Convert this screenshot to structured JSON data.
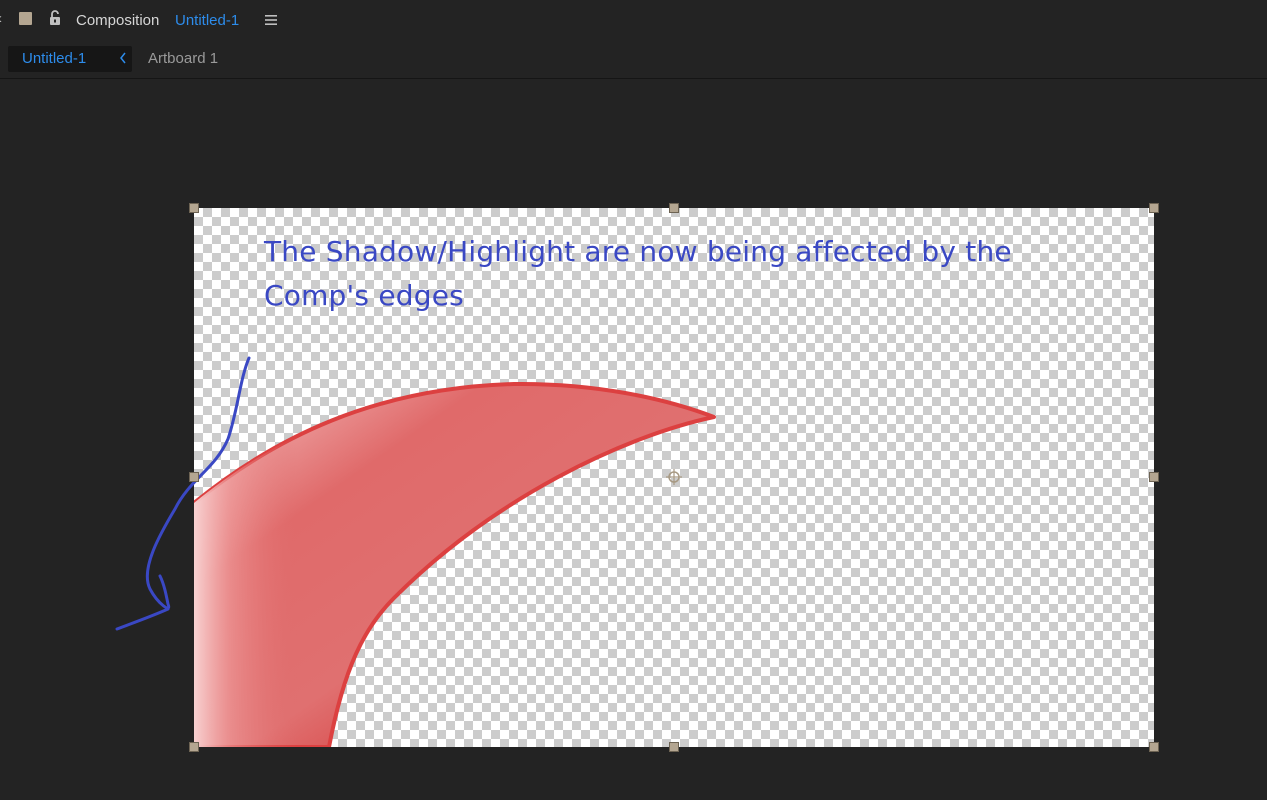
{
  "panel": {
    "label": "Composition",
    "comp_name": "Untitled-1",
    "icons": {
      "collapse": "chevron-left-icon",
      "color_swatch": "square-swatch-icon",
      "lock": "unlock-icon",
      "menu": "hamburger-menu-icon"
    },
    "chevron_glyph": "‹"
  },
  "tabs": {
    "active_label": "Untitled-1",
    "breadcrumb": "Artboard 1",
    "back_icon": "chevron-left-icon"
  },
  "canvas": {
    "annotation_text": "The Shadow/Highlight are now being affected by the Comp's edges",
    "colors": {
      "annotation": "#3a48c4",
      "shape_stroke": "#dc4040",
      "shape_fill_light": "#f6c8c8",
      "shape_fill_dark": "#d02020",
      "handle": "#b4a691",
      "accent_blue": "#2d8ceb"
    }
  }
}
